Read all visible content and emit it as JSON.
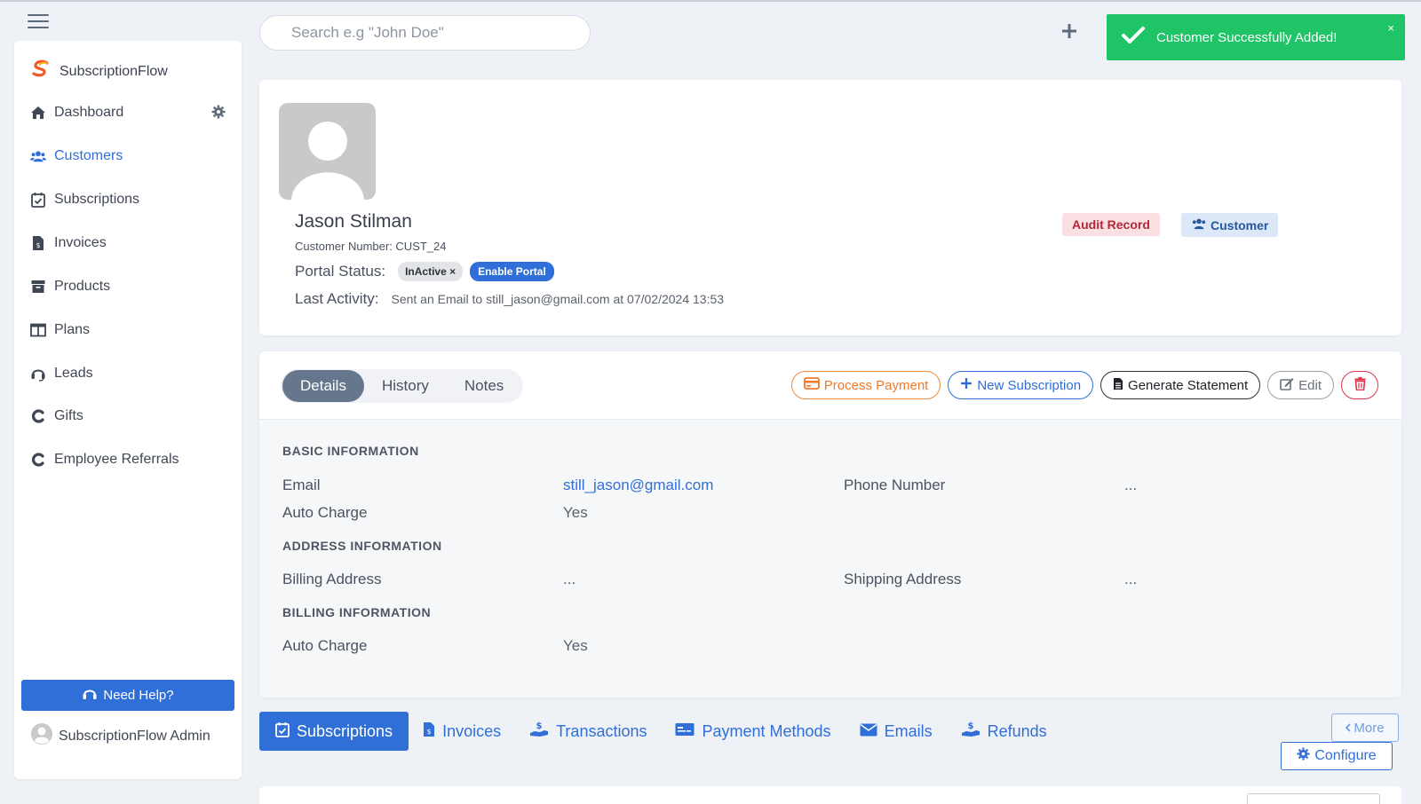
{
  "brand": {
    "name": "SubscriptionFlow"
  },
  "sidebar": {
    "items": [
      {
        "label": "Dashboard",
        "icon": "home-icon"
      },
      {
        "label": "Customers",
        "icon": "users-icon",
        "active": true
      },
      {
        "label": "Subscriptions",
        "icon": "calendar-check-icon"
      },
      {
        "label": "Invoices",
        "icon": "invoice-icon"
      },
      {
        "label": "Products",
        "icon": "archive-icon"
      },
      {
        "label": "Plans",
        "icon": "columns-icon"
      },
      {
        "label": "Leads",
        "icon": "headset-icon"
      },
      {
        "label": "Gifts",
        "icon": "gift-c-icon"
      },
      {
        "label": "Employee Referrals",
        "icon": "referral-c-icon"
      }
    ],
    "help_label": "Need Help?",
    "admin_label": "SubscriptionFlow Admin"
  },
  "search": {
    "placeholder": "Search e.g \"John Doe\""
  },
  "toast": {
    "message": "Customer Successfully Added!",
    "close": "×"
  },
  "profile": {
    "name": "Jason Stilman",
    "customer_number": "Customer Number: CUST_24",
    "portal_label": "Portal Status:",
    "portal_status": "InActive ×",
    "enable_portal": "Enable Portal",
    "last_activity_label": "Last Activity:",
    "last_activity_value": "Sent an Email to still_jason@gmail.com at 07/02/2024 13:53",
    "audit_label": "Audit Record",
    "customer_badge": "Customer"
  },
  "details": {
    "tabs": [
      "Details",
      "History",
      "Notes"
    ],
    "actions": {
      "process_payment": "Process Payment",
      "new_subscription": "New Subscription",
      "generate_statement": "Generate Statement",
      "edit": "Edit"
    },
    "basic_heading": "BASIC INFORMATION",
    "email_label": "Email",
    "email_value": "still_jason@gmail.com",
    "phone_label": "Phone Number",
    "phone_value": "...",
    "auto_charge_label": "Auto Charge",
    "auto_charge_value": "Yes",
    "address_heading": "ADDRESS INFORMATION",
    "billing_address_label": "Billing Address",
    "billing_address_value": "...",
    "shipping_address_label": "Shipping Address",
    "shipping_address_value": "...",
    "billing_heading": "BILLING INFORMATION",
    "billing_auto_charge_label": "Auto Charge",
    "billing_auto_charge_value": "Yes"
  },
  "bottom_tabs": [
    "Subscriptions",
    "Invoices",
    "Transactions",
    "Payment Methods",
    "Emails",
    "Refunds"
  ],
  "more_label": "More",
  "configure_label": "Configure",
  "colors": {
    "accent": "#2f6fd7",
    "toast": "#1fc466",
    "danger": "#e0334a",
    "warning": "#f07a28"
  }
}
